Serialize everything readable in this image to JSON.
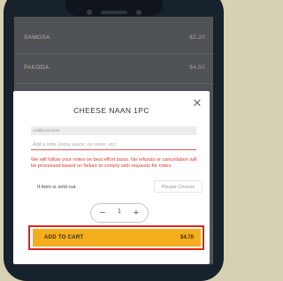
{
  "menu": {
    "items": [
      {
        "name": "SAMOSA",
        "price": "$2.20"
      },
      {
        "name": "PAKODA",
        "price": "$4.50"
      }
    ]
  },
  "modal": {
    "title": "CHEESE NAAN 1PC",
    "close_icon": "close-icon",
    "note_label": "Additional Note",
    "note_placeholder": "Add a note (extra sauce, no onion, etc)",
    "note_value": "",
    "warning": "We will follow your notes on best effort basis. No refunds or cancellation will be processed based on failure to comply with requests for notes.",
    "sold_out_label": "If item is sold out",
    "sold_out_select": "Please Choose",
    "quantity": "1",
    "minus_icon": "minus-icon",
    "plus_icon": "plus-icon",
    "add_to_cart_label": "ADD TO CART",
    "add_to_cart_price": "$4.70"
  },
  "colors": {
    "accent": "#f3ad1d",
    "highlight": "#e0231b",
    "warning_text": "#e03b2e"
  }
}
